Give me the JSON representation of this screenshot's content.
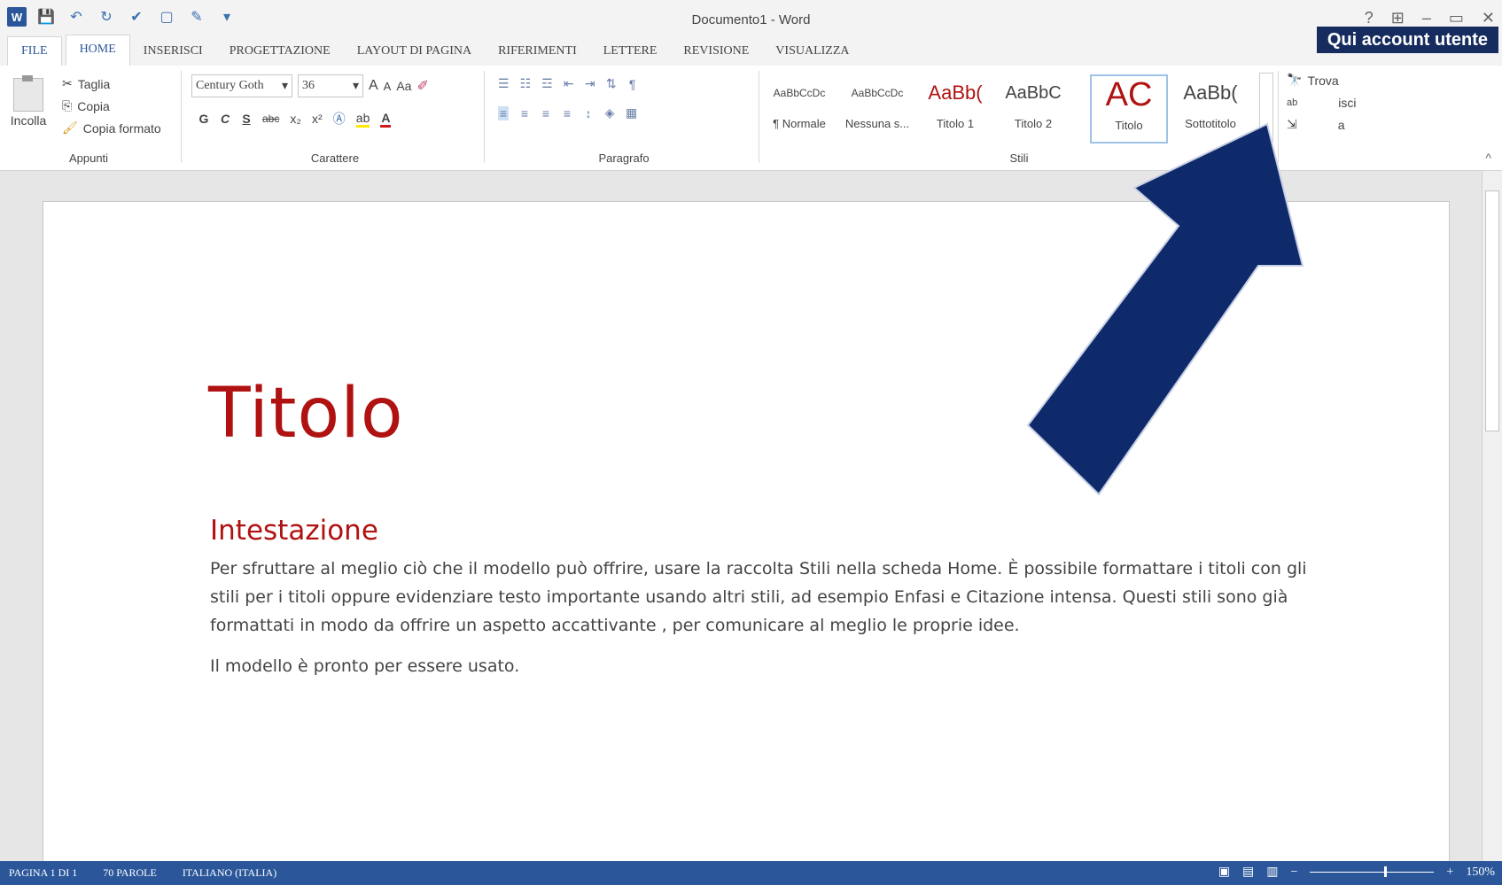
{
  "window": {
    "title": "Documento1 - Word",
    "help_icon": "?",
    "minimize": "–",
    "restore": "▭",
    "close": "✕"
  },
  "tabs": [
    "FILE",
    "HOME",
    "INSERISCI",
    "PROGETTAZIONE",
    "LAYOUT DI PAGINA",
    "RIFERIMENTI",
    "LETTERE",
    "REVISIONE",
    "VISUALIZZA"
  ],
  "active_tab": "HOME",
  "annotation": {
    "label": "Qui account utente",
    "arrow_color": "#0f2a6b"
  },
  "clipboard": {
    "paste": "Incolla",
    "cut": "Taglia",
    "copy": "Copia",
    "format_painter": "Copia formato",
    "group": "Appunti"
  },
  "font": {
    "name": "Century Goth",
    "size": "36",
    "group": "Carattere",
    "bold": "G",
    "italic": "C",
    "underline": "S",
    "strike": "abc",
    "sub": "x₂",
    "sup": "x²",
    "grow": "A",
    "shrink": "A",
    "case": "Aa"
  },
  "paragraph": {
    "group": "Paragrafo"
  },
  "styles": {
    "group": "Stili",
    "items": [
      {
        "preview": "AaBbCcDc",
        "name": "¶ Normale"
      },
      {
        "preview": "AaBbCcDc",
        "name": "Nessuna s..."
      },
      {
        "preview": "AaBb(",
        "name": "Titolo 1"
      },
      {
        "preview": "AaBbC",
        "name": "Titolo 2"
      },
      {
        "preview": "AC",
        "name": "Titolo"
      },
      {
        "preview": "AaBb(",
        "name": "Sottotitolo"
      }
    ]
  },
  "editing": {
    "find": "Trova",
    "replace": "isci",
    "select": "a"
  },
  "document": {
    "title": "Titolo",
    "heading": "Intestazione",
    "paragraph1": "Per sfruttare al meglio ciò che il modello può offrire, usare la raccolta Stili nella scheda Home. È possibile formattare  i titoli con gli stili per i titoli oppure evidenziare testo importante usando altri stili, ad esempio Enfasi e Citazione intensa. Questi stili sono già formattati  in modo da offrire un aspetto accattivante , per comunicare al meglio le proprie idee.",
    "paragraph2": "Il modello è pronto per essere usato."
  },
  "status": {
    "page": "PAGINA 1 DI 1",
    "words": "70 PAROLE",
    "language": "ITALIANO (ITALIA)",
    "zoom": "150%",
    "zoom_fraction": 0.6
  }
}
